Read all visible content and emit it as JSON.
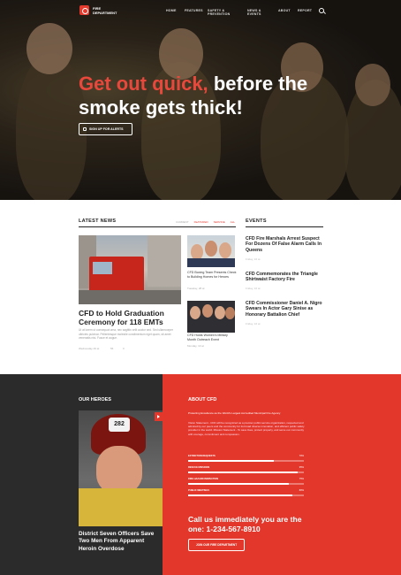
{
  "brand": {
    "name": "FIRE DEPARTMENT"
  },
  "nav": {
    "items": [
      "HOME",
      "FEATURES",
      "SAFETY & PREVENTION",
      "NEWS & EVENTS",
      "ABOUT",
      "REPORT"
    ],
    "search_icon": "search-icon"
  },
  "hero": {
    "headline_accent": "Get out quick,",
    "headline_rest": "before the smoke gets thick!",
    "button_label": "SIGN UP FOR ALERTS"
  },
  "news": {
    "title": "LATEST NEWS",
    "tabs": [
      "CURRENT",
      "FEATURED",
      "SERVICE",
      "ALL"
    ],
    "active_tab": "FEATURED",
    "main": {
      "title": "CFD to Hold Graduation Ceremony for 118 EMTs",
      "excerpt": "Ut at lorem ut consequat urna, nec sagittis velit auctor sed. Sed ullamcorper ultricies pulvinar. Pellentesque molestie condimentum eget quam, sit amet venenatis nisi. Fusce et augue.",
      "date": "Wednesday 29 at",
      "views": "56",
      "comments": "0"
    },
    "side": [
      {
        "title": "CFD Boxing Team Presents Check to Building Homes for Heroes",
        "date": "Tuesday, 28 at"
      },
      {
        "title": "CFD Holds Women's Military Month Outreach Event",
        "date": "Monday, 13 at"
      }
    ]
  },
  "events": {
    "title": "EVENTS",
    "items": [
      {
        "title": "CFD Fire Marshals Arrest Suspect For Dozens Of False Alarm Calls In Queens",
        "date": "Friday, 16 at"
      },
      {
        "title": "CFD Commemorates the Triangle Shirtwaist Factory Fire",
        "date": "Friday, 16 at"
      },
      {
        "title": "CFD Commissioner Daniel A. Nigro Swears In Actor Gary Sinise as Honorary Battalion Chief",
        "date": "Friday, 16 at"
      }
    ]
  },
  "heroes": {
    "title": "OUR HEROES",
    "helmet_number": "282",
    "caption": "District Seven Officers Save Two Men From Apparent Heroin Overdose"
  },
  "about": {
    "title": "ABOUT CFD",
    "lead": "Protecting Excellence as the World's Largest Accredited Municipal Fire Agency",
    "text": "Vision Statement - CFD will be recognized as a premier public service organization, respected and admired by our peers and the community for its broad diverse innovation, and efficient public safety provider in the world. Mission Statement - To save lives, protect property, and serve our community with courage, commitment and compassion.",
    "stats": [
      {
        "label": "EXTINCTION REQUESTS",
        "value": "70%",
        "fraction": 0.74
      },
      {
        "label": "RESCUE MISSIONS",
        "value": "95%",
        "fraction": 0.95
      },
      {
        "label": "FIRE HAZARD INSPECTION",
        "value": "75%",
        "fraction": 0.87
      },
      {
        "label": "PUBLIC MEETINGS",
        "value": "80%",
        "fraction": 0.9
      }
    ],
    "call_text": "Call us immediately you are the one: 1-234-567-8910",
    "button_label": "JOIN OUR FIRE DEPARTMENT"
  },
  "colors": {
    "accent": "#e3372b",
    "dark": "#2b2b2b"
  }
}
